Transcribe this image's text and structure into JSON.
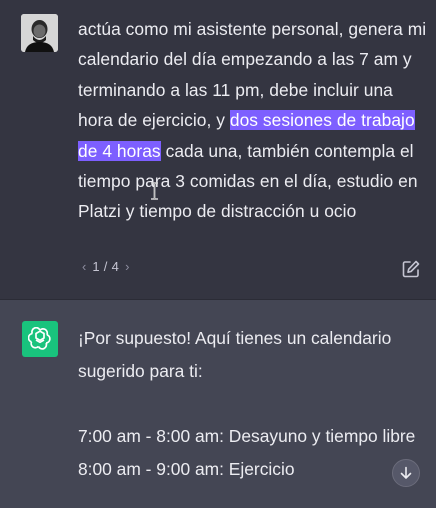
{
  "user_message": {
    "text_before": "actúa como mi asistente personal, genera mi calendario del día empezando a las 7 am y terminando a las 11 pm, debe incluir una hora de ejercicio, y ",
    "highlighted": "dos sesiones de trabajo de 4 horas",
    "text_after": " cada una, también contempla el tiempo para 3 comidas en el día, estudio en Platzi y tiempo de distracción u ocio",
    "pager": {
      "prev": "‹",
      "count": "1 / 4",
      "next": "›"
    }
  },
  "assistant_message": {
    "intro": "¡Por supuesto! Aquí tienes un calendario sugerido para ti:",
    "schedule": [
      "7:00 am - 8:00 am: Desayuno y tiempo libre",
      "8:00 am - 9:00 am: Ejercicio"
    ]
  },
  "colors": {
    "user_bg": "#343541",
    "assistant_bg": "#444654",
    "highlight": "#7d5fff",
    "gpt_logo": "#19c37d"
  },
  "icons": [
    "avatar",
    "edit-icon",
    "chatgpt-logo-icon",
    "arrow-down-icon",
    "text-cursor-icon"
  ]
}
